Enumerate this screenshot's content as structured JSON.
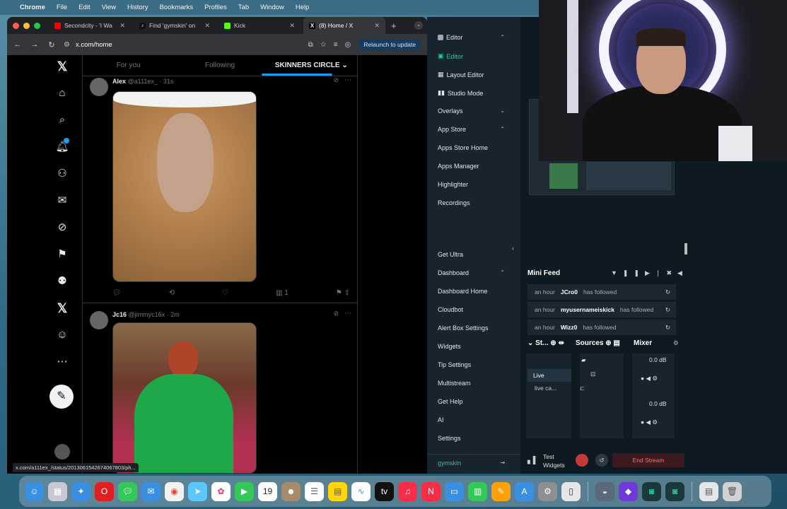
{
  "menubar": {
    "items": [
      "Chrome",
      "File",
      "Edit",
      "View",
      "History",
      "Bookmarks",
      "Profiles",
      "Tab",
      "Window",
      "Help"
    ]
  },
  "browser": {
    "tabs": [
      {
        "title": "Secondcity - 'I Wa",
        "color": "#ff0000"
      },
      {
        "title": "Find 'gymskin' on",
        "color": "#111111"
      },
      {
        "title": "Kick",
        "color": "#53fc18"
      },
      {
        "title": "(8) Home / X",
        "color": "#000000"
      }
    ],
    "url": "x.com/home",
    "relaunch_label": "Relaunch to update",
    "status_url": "x.com/a111ex_/status/2013061542674067803/ph..."
  },
  "x": {
    "nav_icons": [
      "x-logo-icon",
      "home-icon",
      "search-icon",
      "notifications-icon",
      "follow-icon",
      "messages-icon",
      "grok-icon",
      "bookmarks-icon",
      "communities-icon",
      "premium-x-icon",
      "profile-icon",
      "more-icon"
    ],
    "tabs": [
      "For you",
      "Following",
      "SKINNERS CIRCLE"
    ],
    "posts": [
      {
        "name": "Alex",
        "handle": "@a111ex_ · 31s",
        "stats": "1"
      },
      {
        "name": "Jc16",
        "handle": "@jimmyc16x · 2m",
        "stats": ""
      }
    ]
  },
  "streamlabs": {
    "menu": [
      {
        "label": "Editor",
        "chevron": "⌃"
      },
      {
        "label": "Editor",
        "active": true
      },
      {
        "label": "Layout Editor"
      },
      {
        "label": "Studio Mode"
      },
      {
        "label": "Overlays",
        "chevron": "⌄"
      },
      {
        "label": "App Store",
        "chevron": "⌃"
      },
      {
        "label": "Apps Store Home"
      },
      {
        "label": "Apps Manager"
      },
      {
        "label": "Highlighter"
      },
      {
        "label": "Recordings"
      },
      {
        "label": "Get Ultra"
      },
      {
        "label": "Dashboard",
        "chevron": "⌃"
      },
      {
        "label": "Dashboard Home"
      },
      {
        "label": "Cloudbot"
      },
      {
        "label": "Alert Box Settings"
      },
      {
        "label": "Widgets"
      },
      {
        "label": "Tip Settings"
      },
      {
        "label": "Multistream"
      },
      {
        "label": "Get Help"
      },
      {
        "label": "AI"
      },
      {
        "label": "Settings"
      },
      {
        "label": "gymskin"
      }
    ],
    "mini_feed": {
      "title": "Mini Feed",
      "rows": [
        {
          "time": "an hour",
          "user": "JCro0",
          "action": "has followed"
        },
        {
          "time": "an hour",
          "user": "myusernameiskick",
          "action": "has followed"
        },
        {
          "time": "an hour",
          "user": "Wizz0",
          "action": "has followed"
        }
      ]
    },
    "scenes": {
      "title": "St...",
      "items": [
        "Live",
        "live ca..."
      ]
    },
    "sources_title": "Sources",
    "mixer": {
      "title": "Mixer",
      "levels": [
        "0.0 dB",
        "0.0 dB"
      ]
    },
    "bottom": {
      "test_widgets": "Test Widgets",
      "end_stream": "End Stream"
    }
  },
  "dock": {
    "apps": [
      "finder-icon",
      "launchpad-icon",
      "safari-icon",
      "opera-icon",
      "messages-icon",
      "mail-icon",
      "chrome-icon",
      "maps-icon",
      "photos-icon",
      "facetime-icon",
      "calendar-icon",
      "contacts-icon",
      "reminders-icon",
      "notes-icon",
      "freeform-icon",
      "tv-icon",
      "music-icon",
      "news-icon",
      "keynote-icon",
      "numbers-icon",
      "pages-icon",
      "appstore-icon",
      "settings-icon",
      "iphone-mirroring-icon",
      "drive-icon",
      "obsidian-icon",
      "streamlabs-icon",
      "streamlabs2-icon",
      "downloads-icon",
      "trash-icon"
    ],
    "calendar_day": "19",
    "appletv_label": "tv"
  }
}
